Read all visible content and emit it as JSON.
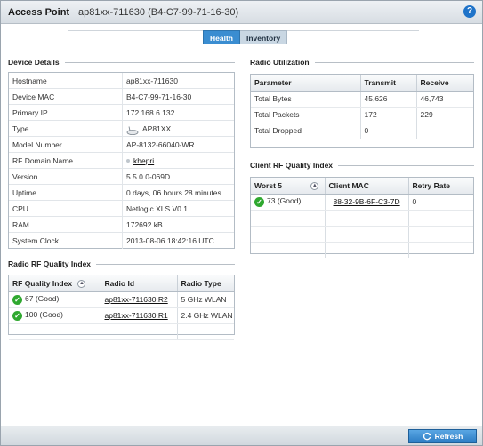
{
  "header": {
    "title": "Access Point",
    "subtitle": "ap81xx-711630 (B4-C7-99-71-16-30)"
  },
  "tabs": [
    {
      "label": "Health",
      "active": true
    },
    {
      "label": "Inventory",
      "active": false
    }
  ],
  "device_details": {
    "title": "Device Details",
    "rows": [
      {
        "key": "Hostname",
        "value": "ap81xx-711630"
      },
      {
        "key": "Device MAC",
        "value": "B4-C7-99-71-16-30"
      },
      {
        "key": "Primary IP",
        "value": "172.168.6.132"
      },
      {
        "key": "Type",
        "value": "AP81XX",
        "icon": "access-point-icon"
      },
      {
        "key": "Model Number",
        "value": "AP-8132-66040-WR"
      },
      {
        "key": "RF Domain Name",
        "value": "khepri",
        "link": true
      },
      {
        "key": "Version",
        "value": "5.5.0.0-069D"
      },
      {
        "key": "Uptime",
        "value": "0 days, 06 hours 28 minutes"
      },
      {
        "key": "CPU",
        "value": "Netlogic XLS V0.1"
      },
      {
        "key": "RAM",
        "value": "172692 kB"
      },
      {
        "key": "System Clock",
        "value": "2013-08-06 18:42:16 UTC"
      }
    ]
  },
  "radio_rf": {
    "title": "Radio RF Quality Index",
    "headers": [
      "RF Quality Index",
      "Radio Id",
      "Radio Type"
    ],
    "rows": [
      {
        "quality": "67 (Good)",
        "radio_id": "ap81xx-711630:R2",
        "radio_type": "5 GHz WLAN"
      },
      {
        "quality": "100 (Good)",
        "radio_id": "ap81xx-711630:R1",
        "radio_type": "2.4 GHz WLAN"
      }
    ]
  },
  "radio_util": {
    "title": "Radio Utilization",
    "headers": [
      "Parameter",
      "Transmit",
      "Receive"
    ],
    "rows": [
      {
        "param": "Total Bytes",
        "tx": "45,626",
        "rx": "46,743"
      },
      {
        "param": "Total Packets",
        "tx": "172",
        "rx": "229"
      },
      {
        "param": "Total Dropped",
        "tx": "0",
        "rx": ""
      }
    ]
  },
  "client_rf": {
    "title": "Client RF Quality Index",
    "headers": [
      "Worst 5",
      "Client MAC",
      "Retry Rate"
    ],
    "rows": [
      {
        "quality": "73 (Good)",
        "mac": "88-32-9B-6F-C3-7D",
        "retry": "0"
      }
    ]
  },
  "footer": {
    "refresh_label": "Refresh"
  },
  "colors": {
    "accent": "#3a8dd1",
    "good": "#2fa82f",
    "help": "#1f73c9"
  }
}
